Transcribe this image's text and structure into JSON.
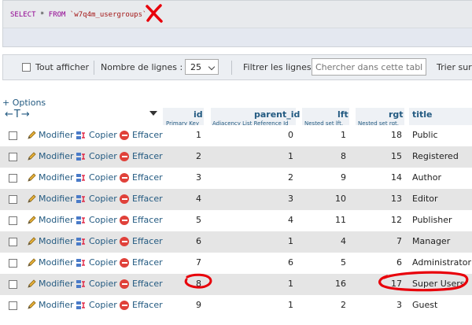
{
  "query": {
    "select_kw": "SELECT",
    "star": "*",
    "from_kw": "FROM",
    "table": "`w7q4m_usergroups`"
  },
  "toolbar": {
    "show_all": "Tout afficher",
    "rows_label": "Nombre de lignes :",
    "rows_value": "25",
    "filter_label": "Filtrer les lignes:",
    "search_placeholder": "Chercher dans cette table",
    "sort_label": "Trier sur l"
  },
  "options_link": "+ Options",
  "nav_arrows": "←T→",
  "columns": [
    {
      "name": "id",
      "sub": "Primary Key"
    },
    {
      "name": "parent_id",
      "sub": "Adjacency List Reference Id"
    },
    {
      "name": "lft",
      "sub": "Nested set lft."
    },
    {
      "name": "rgt",
      "sub": "Nested set rgt."
    },
    {
      "name": "title",
      "sub": ""
    }
  ],
  "actions": {
    "edit": "Modifier",
    "copy": "Copier",
    "delete": "Effacer"
  },
  "rows": [
    {
      "id": "1",
      "parent_id": "0",
      "lft": "1",
      "rgt": "18",
      "title": "Public"
    },
    {
      "id": "2",
      "parent_id": "1",
      "lft": "8",
      "rgt": "15",
      "title": "Registered"
    },
    {
      "id": "3",
      "parent_id": "2",
      "lft": "9",
      "rgt": "14",
      "title": "Author"
    },
    {
      "id": "4",
      "parent_id": "3",
      "lft": "10",
      "rgt": "13",
      "title": "Editor"
    },
    {
      "id": "5",
      "parent_id": "4",
      "lft": "11",
      "rgt": "12",
      "title": "Publisher"
    },
    {
      "id": "6",
      "parent_id": "1",
      "lft": "4",
      "rgt": "7",
      "title": "Manager"
    },
    {
      "id": "7",
      "parent_id": "6",
      "lft": "5",
      "rgt": "6",
      "title": "Administrator"
    },
    {
      "id": "8",
      "parent_id": "1",
      "lft": "16",
      "rgt": "17",
      "title": "Super Users"
    },
    {
      "id": "9",
      "parent_id": "1",
      "lft": "2",
      "rgt": "3",
      "title": "Guest"
    }
  ],
  "colors": {
    "link": "#235a81",
    "annotation": "#e8000a",
    "row_even": "#e5e5e5"
  }
}
